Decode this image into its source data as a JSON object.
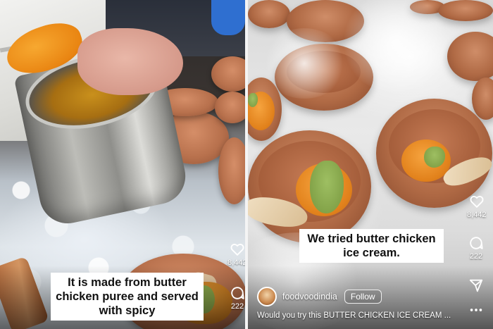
{
  "left_post": {
    "caption": "It is made from butter chicken puree and served with spicy",
    "likes": "8,442",
    "comments": "222"
  },
  "right_post": {
    "caption": "We tried butter chicken ice cream.",
    "likes": "8,442",
    "comments": "222",
    "username": "foodvoodindia",
    "follow_label": "Follow",
    "description": "Would you try this BUTTER CHICKEN ICE CREAM ...",
    "more_label": "..."
  },
  "icons": {
    "like": "heart-icon",
    "comment": "comment-icon",
    "share": "send-icon",
    "more": "more-icon"
  },
  "colors": {
    "caption_bg": "#ffffff",
    "caption_text": "#111111",
    "overlay_text": "#ffffff"
  }
}
